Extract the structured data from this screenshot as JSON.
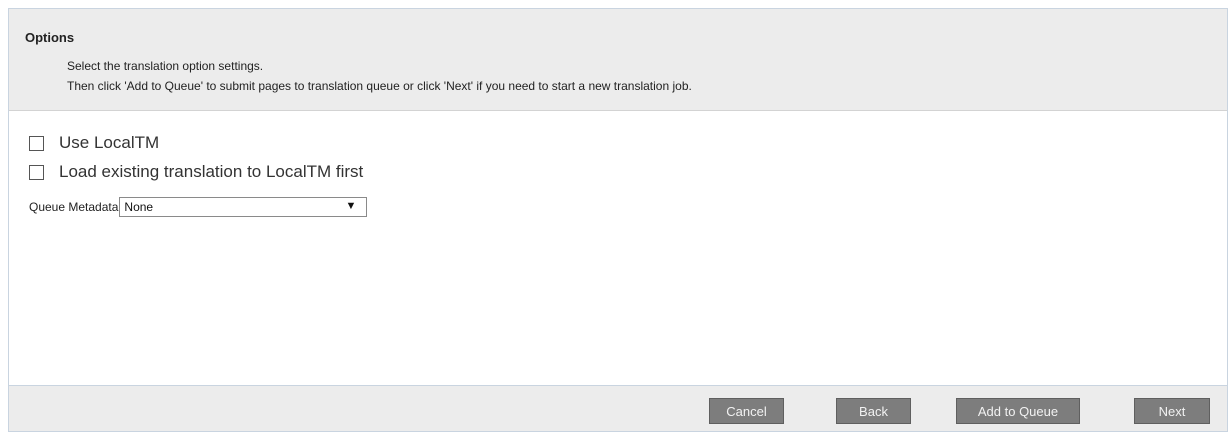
{
  "options_panel": {
    "title": "Options",
    "instruction_line1": "Select the translation option settings.",
    "instruction_line2": "Then click 'Add to Queue' to submit pages to translation queue or click 'Next' if you need to start a new translation job."
  },
  "settings": {
    "use_localtm": {
      "label": "Use LocalTM",
      "checked": false
    },
    "load_existing": {
      "label": "Load existing translation to LocalTM first",
      "checked": false
    },
    "queue_metadata": {
      "label": "Queue Metadata",
      "selected_value": "None"
    }
  },
  "footer": {
    "cancel_label": "Cancel",
    "back_label": "Back",
    "add_to_queue_label": "Add to Queue",
    "next_label": "Next"
  },
  "icons": {
    "select_arrow": "dropdown-arrow-icon"
  },
  "colors": {
    "header_background": "#ececec",
    "footer_background": "#ececec",
    "button_background": "#7d7d7d",
    "button_text": "#f2f2f2",
    "frame_border": "#c9d4e0"
  }
}
